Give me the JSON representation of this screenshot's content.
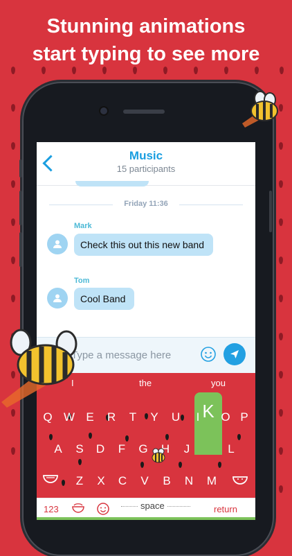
{
  "headline": {
    "line1": "Stunning animations",
    "line2": "start typing to see more"
  },
  "chat": {
    "title": "Music",
    "participants": "15 participants",
    "date_separator": "Friday 11:36",
    "messages": [
      {
        "sender": "Mark",
        "text": "Check this out this new band"
      },
      {
        "sender": "Tom",
        "text": "Cool Band"
      }
    ],
    "input_placeholder": "Type a message here"
  },
  "keyboard": {
    "suggestions": [
      "I",
      "the",
      "you"
    ],
    "row1": [
      "Q",
      "W",
      "E",
      "R",
      "T",
      "Y",
      "U",
      "I",
      "O",
      "P"
    ],
    "row2": [
      "A",
      "S",
      "D",
      "F",
      "G",
      "H",
      "J",
      "K",
      "L"
    ],
    "row3": [
      "Z",
      "X",
      "C",
      "V",
      "B",
      "N",
      "M"
    ],
    "active_key": "K",
    "numbers_label": "123",
    "space_label": "space",
    "return_label": "return"
  },
  "colors": {
    "background": "#d8343e",
    "accent": "#1a9ee0",
    "bubble": "#bfe3f7",
    "active_key": "#7cc25a"
  }
}
